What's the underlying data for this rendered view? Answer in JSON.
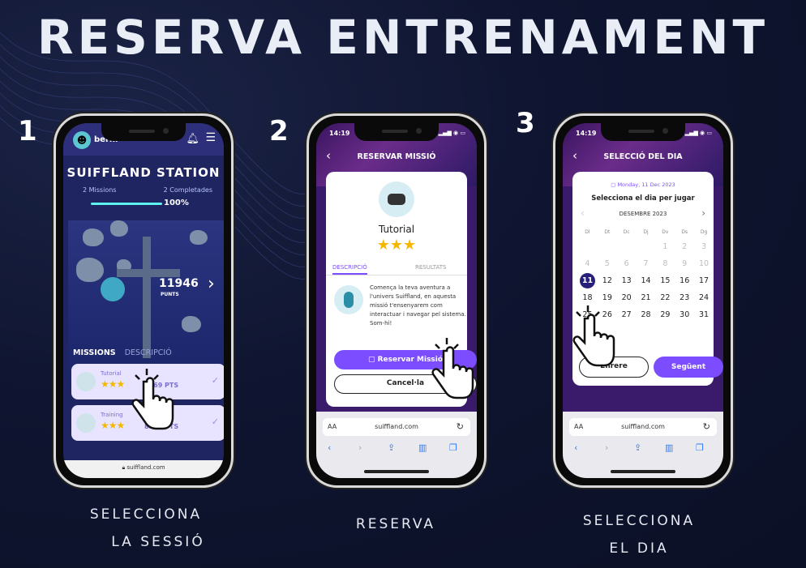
{
  "title": "RESERVA ENTRENAMENT",
  "steps": [
    {
      "number": "1",
      "caption_line1": "SELECCIONA",
      "caption_line2": "LA SESSIÓ"
    },
    {
      "number": "2",
      "caption_line1": "RESERVA",
      "caption_line2": ""
    },
    {
      "number": "3",
      "caption_line1": "SELECCIONA",
      "caption_line2": "EL DIA"
    }
  ],
  "phone1": {
    "username": "berni",
    "station_title": "SUIFFLAND STATION",
    "missions_stat": "2 Missions",
    "completed_stat": "2 Completades",
    "progress_label": "100%",
    "progress": 1.0,
    "points_value": "11946",
    "points_label": "PUNTS",
    "tabs": {
      "missions": "MISSIONS",
      "description": "DESCRIPCIÓ"
    },
    "missions": [
      {
        "name": "Tutorial",
        "stars": "★★★",
        "points": "3369 PTS",
        "icon": "robot-icon"
      },
      {
        "name": "Training",
        "stars": "★★★",
        "points": "8597 PTS",
        "icon": "runner-icon"
      }
    ],
    "url": "suiffland.com"
  },
  "phone2": {
    "time": "14:19",
    "header": "RESERVAR MISSIÓ",
    "mission_name": "Tutorial",
    "stars": "★★★",
    "tab_description": "DESCRIPCIÓ",
    "tab_results": "RESULTATS",
    "description": "Comença la teva aventura a l'univers Suiffland, en aquesta missió t'ensenyarem com interactuar i navegar pel sistema. Som-hi!",
    "reserve_button": "Reservar Missió",
    "cancel_button": "Cancel·la",
    "url": "suiffland.com",
    "aa": "AA"
  },
  "phone3": {
    "time": "14:19",
    "header": "SELECCIÓ DEL DIA",
    "date_line": "Monday, 11 Dec 2023",
    "prompt": "Selecciona el dia per jugar",
    "month": "DESEMBRE 2023",
    "weekdays": [
      "Dl",
      "Dt",
      "Dc",
      "Dj",
      "Dv",
      "Ds",
      "Dg"
    ],
    "weeks": [
      [
        "",
        "",
        "",
        "",
        "1",
        "2",
        "3"
      ],
      [
        "4",
        "5",
        "6",
        "7",
        "8",
        "9",
        "10"
      ],
      [
        "11",
        "12",
        "13",
        "14",
        "15",
        "16",
        "17"
      ],
      [
        "18",
        "19",
        "20",
        "21",
        "22",
        "23",
        "24"
      ],
      [
        "25",
        "26",
        "27",
        "28",
        "29",
        "30",
        "31"
      ]
    ],
    "selected_day": "11",
    "back_button": "Enrere",
    "next_button": "Següent",
    "url": "suiffland.com",
    "aa": "AA"
  },
  "colors": {
    "accent": "#7c4dff",
    "background": "#0f1530",
    "star": "#f5b800",
    "selected": "#26207a"
  }
}
